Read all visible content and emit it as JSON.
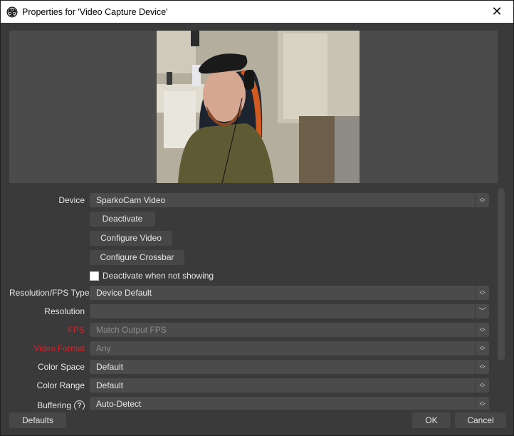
{
  "window": {
    "title": "Properties for 'Video Capture Device'",
    "close_label": "✕"
  },
  "preview": {
    "description": "Webcam preview of a man with beard, cap and headphones in a gaming chair"
  },
  "device": {
    "label": "Device",
    "value": "SparkoCam Video"
  },
  "buttons": {
    "deactivate": "Deactivate",
    "configure_video": "Configure Video",
    "configure_crossbar": "Configure Crossbar"
  },
  "deactivate_when_not_showing": {
    "label": "Deactivate when not showing",
    "checked": false
  },
  "fields": [
    {
      "label": "Resolution/FPS Type",
      "value": "Device Default",
      "arrow": "updown",
      "disabled": false,
      "label_color": "normal"
    },
    {
      "label": "Resolution",
      "value": "",
      "arrow": "down",
      "disabled": false,
      "label_color": "normal"
    },
    {
      "label": "FPS",
      "value": "Match Output FPS",
      "arrow": "updown",
      "disabled": true,
      "label_color": "red"
    },
    {
      "label": "Video Format",
      "value": "Any",
      "arrow": "updown",
      "disabled": true,
      "label_color": "red"
    },
    {
      "label": "Color Space",
      "value": "Default",
      "arrow": "updown",
      "disabled": false,
      "label_color": "normal"
    },
    {
      "label": "Color Range",
      "value": "Default",
      "arrow": "updown",
      "disabled": false,
      "label_color": "normal"
    },
    {
      "label": "Buffering",
      "value": "Auto-Detect",
      "arrow": "updown",
      "disabled": false,
      "label_color": "normal",
      "help": true
    }
  ],
  "footer": {
    "defaults": "Defaults",
    "ok": "OK",
    "cancel": "Cancel"
  },
  "colors": {
    "background": "#3a3a3a",
    "control": "#4b4b4b",
    "error_label": "#d4202a"
  }
}
